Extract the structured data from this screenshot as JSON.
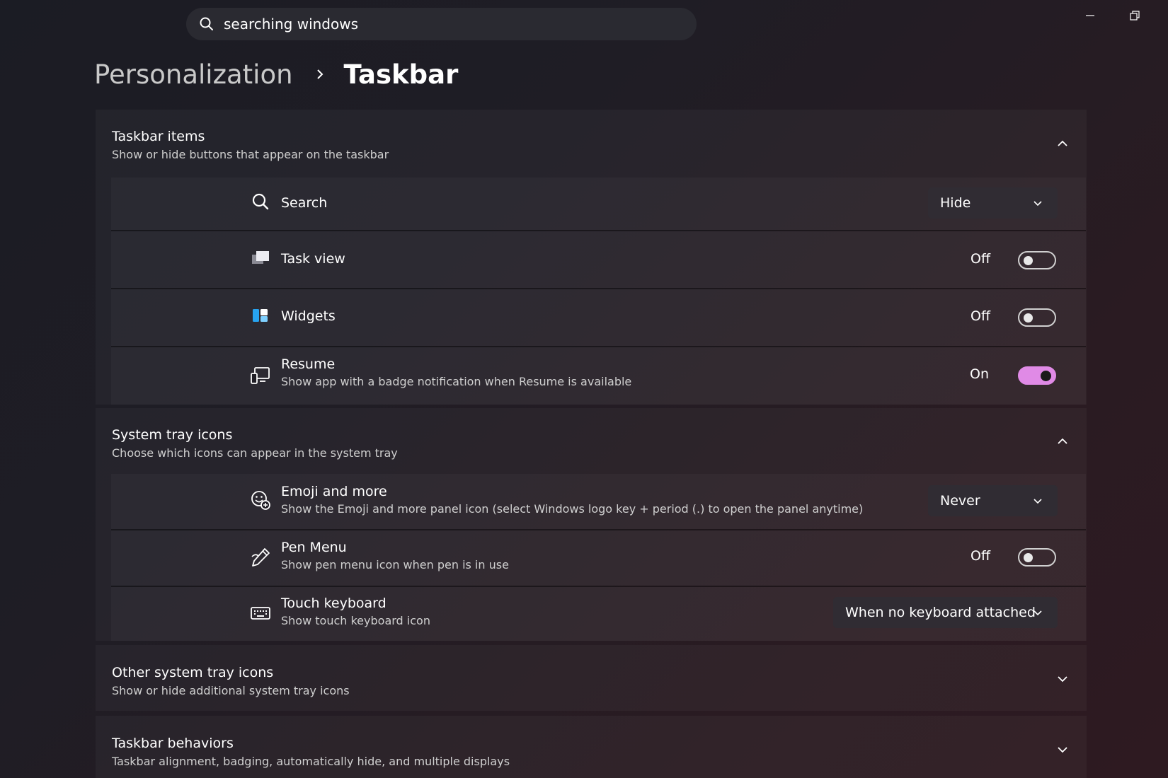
{
  "search": {
    "value": "searching windows"
  },
  "window": {
    "minimize_icon": "minimize-icon",
    "restore_icon": "restore-icon"
  },
  "breadcrumb": {
    "parent": "Personalization",
    "current": "Taskbar"
  },
  "sections": {
    "taskbar_items": {
      "title": "Taskbar items",
      "subtitle": "Show or hide buttons that appear on the taskbar",
      "items": {
        "search": {
          "label": "Search",
          "control": "dropdown",
          "value": "Hide",
          "icon": "search-icon"
        },
        "task_view": {
          "label": "Task view",
          "control": "toggle",
          "state": "Off",
          "icon": "task-view-icon"
        },
        "widgets": {
          "label": "Widgets",
          "control": "toggle",
          "state": "Off",
          "icon": "widgets-icon"
        },
        "resume": {
          "label": "Resume",
          "description": "Show app with a badge notification when Resume is available",
          "control": "toggle",
          "state": "On",
          "icon": "resume-icon"
        }
      }
    },
    "system_tray_icons": {
      "title": "System tray icons",
      "subtitle": "Choose which icons can appear in the system tray",
      "items": {
        "emoji": {
          "label": "Emoji and more",
          "description": "Show the Emoji and more panel icon (select Windows logo key + period (.) to open the panel anytime)",
          "control": "dropdown",
          "value": "Never",
          "icon": "emoji-icon"
        },
        "pen_menu": {
          "label": "Pen Menu",
          "description": "Show pen menu icon when pen is in use",
          "control": "toggle",
          "state": "Off",
          "icon": "pen-icon"
        },
        "touch_keyboard": {
          "label": "Touch keyboard",
          "description": "Show touch keyboard icon",
          "control": "dropdown",
          "value": "When no keyboard attached",
          "icon": "keyboard-icon"
        }
      }
    },
    "other_tray_icons": {
      "title": "Other system tray icons",
      "subtitle": "Show or hide additional system tray icons"
    },
    "taskbar_behaviors": {
      "title": "Taskbar behaviors",
      "subtitle": "Taskbar alignment, badging, automatically hide, and multiple displays"
    }
  },
  "colors": {
    "accent": "#e08ae6",
    "background": "#1f1d25"
  }
}
